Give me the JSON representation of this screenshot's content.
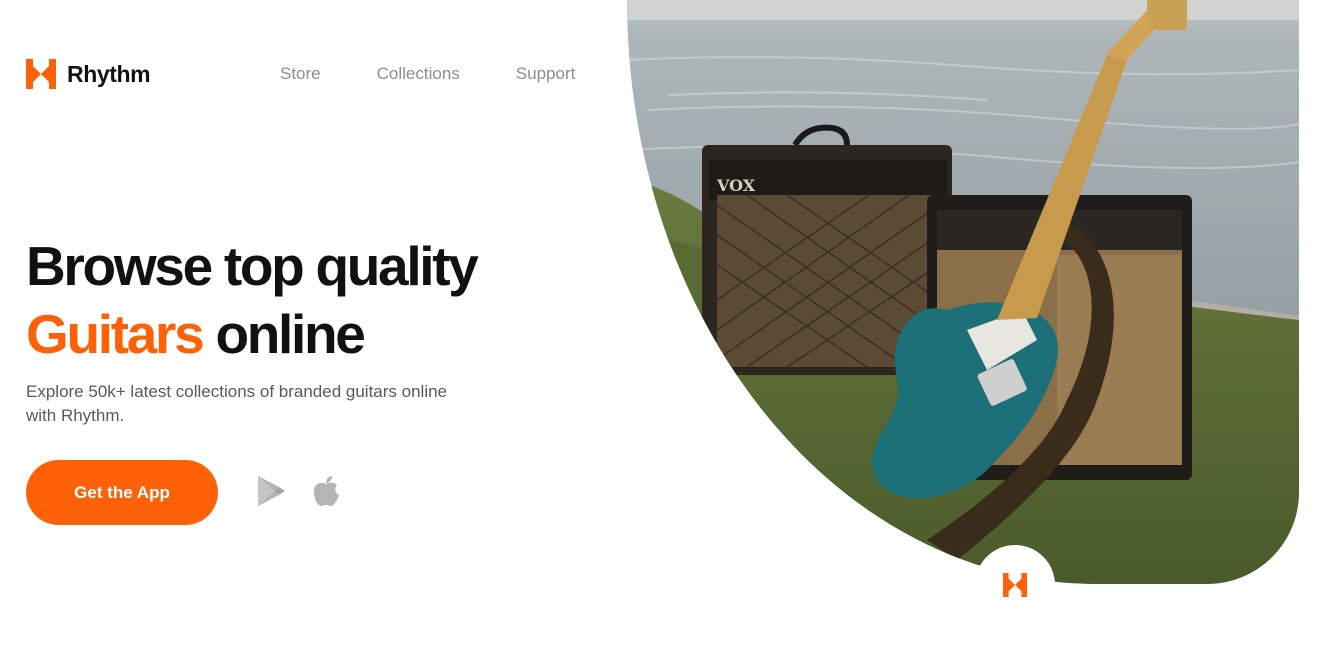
{
  "brand": {
    "name": "Rhythm",
    "logo_icon": "rhythm-logo-icon",
    "color": "#ff6108"
  },
  "nav": {
    "items": [
      {
        "label": "Store"
      },
      {
        "label": "Collections"
      },
      {
        "label": "Support"
      }
    ]
  },
  "hero": {
    "headline_line1": "Browse top quality",
    "headline_accent": "Guitars",
    "headline_line2_rest": "online",
    "subtitle": "Explore 50k+ latest collections of branded guitars online with Rhythm.",
    "cta_label": "Get the App",
    "store_icons": [
      "google-play-icon",
      "apple-icon"
    ],
    "image_alt_icon": "guitar-amplifier-photo"
  },
  "colors": {
    "accent": "#ff6108",
    "text": "#111111",
    "muted": "#8e8e8e",
    "body": "#5a5a5a"
  }
}
